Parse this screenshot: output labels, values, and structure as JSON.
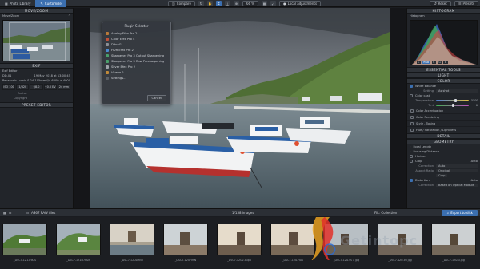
{
  "topbar": {
    "tabs": [
      {
        "label": "Photo Library"
      },
      {
        "label": "Customize"
      }
    ],
    "tools": {
      "compare": "Compare",
      "zoom": "66 %",
      "local_adjustments": "Local adjustments"
    },
    "right": {
      "reset": "Reset",
      "presets": "Presets"
    }
  },
  "left_panel": {
    "navigation_title": "MOVE/ZOOM",
    "move_zoom_label": "Move/Zoom",
    "exif_title": "EXIF",
    "exif_editor_label": "Exif Editor",
    "exif_file": "DD-01",
    "exif_date": "19 May 2018 at 13:00:45",
    "exif_camera": "Panasonic Lumix S 24-105mm f/4 Macro OIS",
    "exif_size": "6000 × 4000",
    "exif_values": [
      "ISO 100",
      "1/320",
      "f/8.0",
      "+0.0 EV",
      "24 mm"
    ],
    "author_label": "Author",
    "copyright_label": "Copyright",
    "preset_editor_title": "PRESET EDITOR"
  },
  "plugin_selector": {
    "title": "Plugin Selector",
    "items": [
      {
        "label": "Analog Efex Pro 2",
        "color": "#b87a3a"
      },
      {
        "label": "Color Efex Pro 4",
        "color": "#c0503a"
      },
      {
        "label": "DfineG",
        "color": "#8a8f96"
      },
      {
        "label": "HDR Efex Pro 2",
        "color": "#4a8ad0"
      },
      {
        "label": "Sharpener Pro 3 Output Sharpening",
        "color": "#4aa06a"
      },
      {
        "label": "Sharpener Pro 3 Raw Presharpening",
        "color": "#4aa06a"
      },
      {
        "label": "Silver Efex Pro 2",
        "color": "#a0a4aa"
      },
      {
        "label": "Viveza 2",
        "color": "#c08a3a"
      },
      {
        "label": "Settings...",
        "color": "#5a5f66"
      }
    ],
    "cancel_label": "Cancel"
  },
  "right_panel": {
    "histogram_title": "HISTOGRAM",
    "histogram_label": "Histogram",
    "channels": [
      "L",
      "RGB",
      "R",
      "G",
      "B"
    ],
    "essential_tools": "ESSENTIAL TOOLS",
    "light": "LIGHT",
    "color": "COLOR",
    "white_balance": "White Balance",
    "wb_setting_label": "Setting",
    "wb_setting_value": "As shot",
    "color_cast": "Color cast",
    "temperature_label": "Temperature",
    "temperature_value": "5500",
    "tint_label": "Tint",
    "tint_value": "0",
    "color_items": [
      "Color Accentuation",
      "Color Rendering",
      "Style - Toning",
      "Hue / Saturation / Lightness"
    ],
    "detail": "DETAIL",
    "geometry": "GEOMETRY",
    "focal_length": "Focal Length",
    "focusing_distance": "Focusing Distance",
    "horizon": "Horizon",
    "crop": "Crop",
    "auto": "Auto",
    "correction_label": "Correction",
    "correction_value": "Auto",
    "aspect_label": "Aspect Ratio",
    "aspect_value": "Original",
    "crop_value": "Crop",
    "distortion": "Distortion",
    "distortion_value": "Based on Optical Module"
  },
  "filmstrip": {
    "folder": "AS67 RAW files",
    "count": "1/158 images",
    "filter_label": "Filt: Collection",
    "export_label": "Export to disk",
    "captions": [
      "_DSC7-1Z1-F9DS",
      "_DSC7-1Z1D7H0S",
      "_DSC7-12D0HN3",
      "_DSC7-12UH9IN",
      "_DSC7-12U2-cupp",
      "_DSC7-1Z0-H01",
      "_DSC7-1Z0-ss 1 jpg",
      "_DSC7-1Z0-cu jpg",
      "_DSC7-1Z0-u.jpg"
    ]
  },
  "watermark": {
    "text": "Getintopc"
  }
}
